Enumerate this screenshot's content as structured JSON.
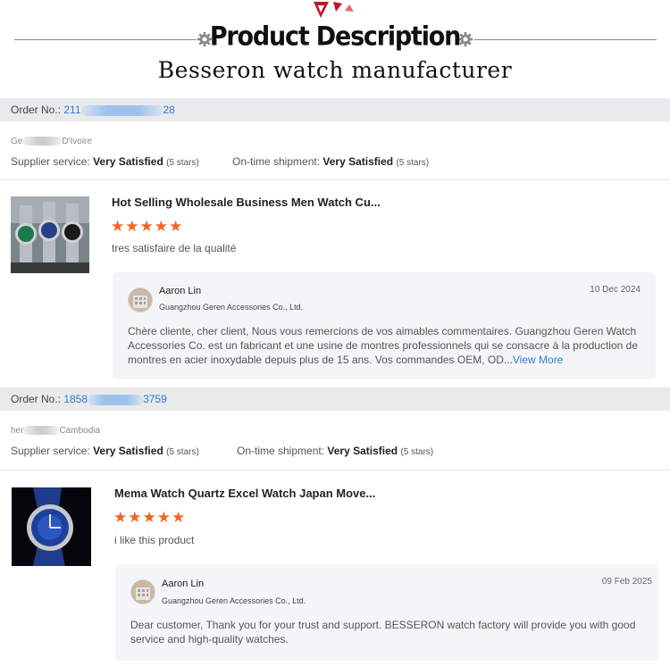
{
  "header": {
    "title": "Product Description",
    "subtitle": "Besseron watch manufacturer"
  },
  "reviews": [
    {
      "order_label": "Order No.:",
      "order_prefix": "211",
      "order_suffix": "28",
      "country_prefix": "Ge",
      "country_suffix": "D'Ivoire",
      "supplier_label": "Supplier service:",
      "supplier_value": "Very Satisfied",
      "supplier_stars": "(5 stars)",
      "shipment_label": "On-time shipment:",
      "shipment_value": "Very Satisfied",
      "shipment_stars": "(5 stars)",
      "product_title": "Hot Selling Wholesale Business Men Watch Cu...",
      "rating": "★★★★★",
      "comment": "tres satisfaire de la qualité",
      "reply": {
        "name": "Aaron Lin",
        "company": "Guangzhou Geren Accessories Co., Ltd.",
        "date": "10 Dec 2024",
        "text": "Chère cliente, cher client, Nous vous remercions de vos aimables commentaires. Guangzhou Geren Watch Accessories Co. est un fabricant et une usine de montres professionnels qui se consacre à la production de montres en acier inoxydable depuis plus de 15 ans. Vos commandes OEM, OD...",
        "more": "View More"
      }
    },
    {
      "order_label": "Order No.:",
      "order_prefix": "1858",
      "order_suffix": "3759",
      "country_prefix": "her",
      "country_suffix": "Cambodia",
      "supplier_label": "Supplier service:",
      "supplier_value": "Very Satisfied",
      "supplier_stars": "(5 stars)",
      "shipment_label": "On-time shipment:",
      "shipment_value": "Very Satisfied",
      "shipment_stars": "(5 stars)",
      "product_title": "Mema Watch Quartz Excel Watch Japan Move...",
      "rating": "★★★★★",
      "comment": "i like this product",
      "reply": {
        "name": "Aaron Lin",
        "company": "Guangzhou Geren Accessories Co., Ltd.",
        "date": "09 Feb 2025",
        "text": "Dear customer, Thank you for your trust and support. BESSERON watch factory will provide you with good service and high-quality watches."
      }
    }
  ],
  "colors": {
    "link": "#2f7bd3",
    "star": "#f26522",
    "bar": "#e9eaec",
    "reply_bg": "#f4f5f7"
  }
}
